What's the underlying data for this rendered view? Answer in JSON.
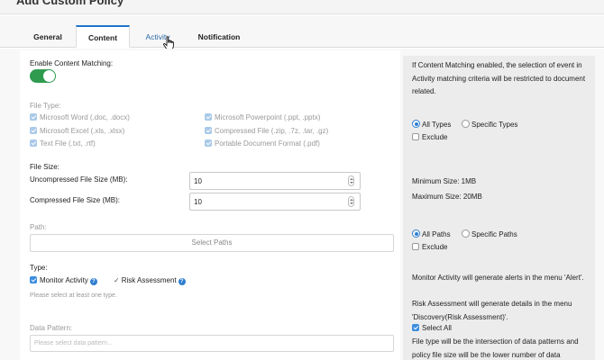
{
  "header": {
    "title": "Add Custom Policy"
  },
  "tabs": [
    "General",
    "Content",
    "Activity",
    "Notification"
  ],
  "form": {
    "enable_label": "Enable Content Matching:",
    "file_type_label": "File Type:",
    "file_types": [
      "Microsoft Word (.doc, .docx)",
      "Microsoft Excel (.xls, .xlsx)",
      "Text File (.txt, .rtf)",
      "Microsoft Powerpoint (.ppt, .pptx)",
      "Compressed File (.zip, .7z, .tar, .gz)",
      "Portable Document Format (.pdf)"
    ],
    "file_size_label": "File Size:",
    "uncompressed_label": "Uncompressed File Size (MB):",
    "uncompressed_value": "10",
    "compressed_label": "Compressed File Size (MB):",
    "compressed_value": "10",
    "path_label": "Path:",
    "select_paths": "Select Paths",
    "type_label": "Type:",
    "monitor_activity": "Monitor Activity",
    "risk_assessment": "Risk Assessment",
    "type_hint": "Please select at least one type.",
    "data_pattern_label": "Data Pattern:",
    "data_pattern_placeholder": "Please select data pattern..."
  },
  "help": {
    "content_matching": "If Content Matching enabled, the selection of event in Activity matching criteria will be restricted to document related.",
    "all_types": "All Types",
    "specific_types": "Specific Types",
    "exclude": "Exclude",
    "min_size": "Minimum Size: 1MB",
    "max_size": "Maximum Size: 20MB",
    "all_paths": "All Paths",
    "specific_paths": "Specific Paths",
    "monitor_note_1": "Monitor Activity will generate alerts in the menu 'Alert'.",
    "monitor_note_2": "Risk Assessment will generate details in the menu 'Discovery(Risk Assessment)'.",
    "select_all": "Select All",
    "intersection_note": "File type will be the intersection of data patterns and policy file size will be the lower number of data"
  },
  "colors": {
    "accent": "#1e74c8",
    "toggle_on": "#2e9b4f"
  }
}
